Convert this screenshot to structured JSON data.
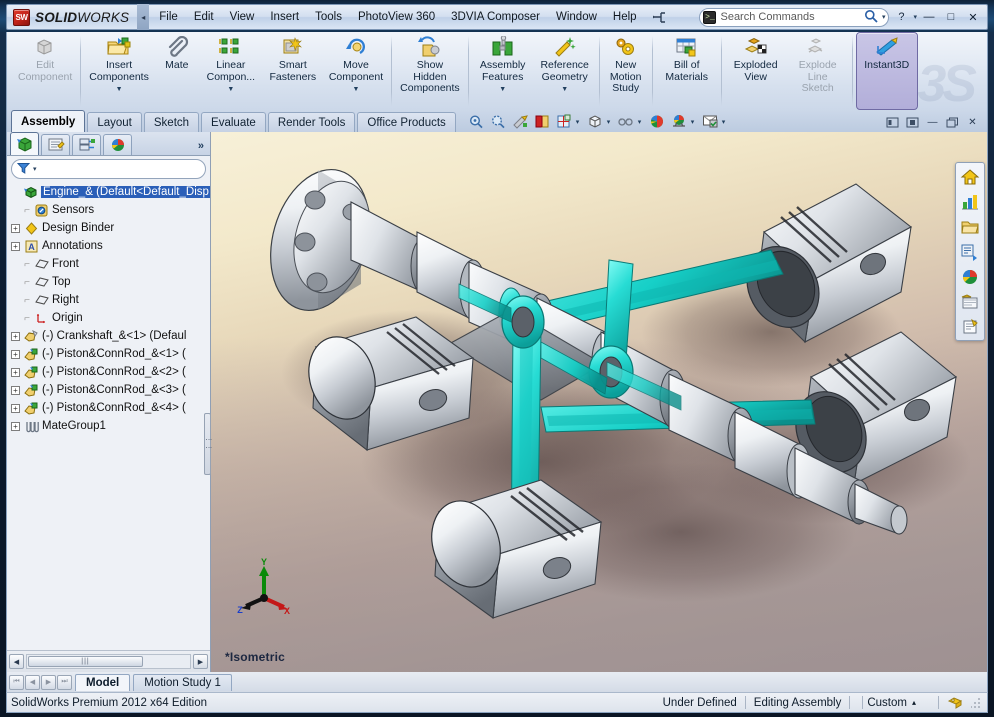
{
  "app": {
    "brand_sw": "SOLID",
    "brand_works": "WORKS",
    "logo_text": "SW",
    "watermark": "3S"
  },
  "menu": {
    "items": [
      {
        "label": "File"
      },
      {
        "label": "Edit"
      },
      {
        "label": "View"
      },
      {
        "label": "Insert"
      },
      {
        "label": "Tools"
      },
      {
        "label": "PhotoView 360"
      },
      {
        "label": "3DVIA Composer"
      },
      {
        "label": "Window"
      },
      {
        "label": "Help"
      }
    ],
    "collapse_arrow": "◂",
    "pin_icon": "pin-icon"
  },
  "search": {
    "placeholder": "Search Commands",
    "dropdown_arrow": "▾",
    "prompt": ">_"
  },
  "titlebar_buttons": {
    "help": "?",
    "help_arrow": "▾",
    "minimize": "—",
    "restore": "□",
    "close": "✕"
  },
  "ribbon": {
    "buttons": [
      {
        "name": "edit-component",
        "label": "Edit\nComponent",
        "disabled": true,
        "dropdown": false
      },
      {
        "name": "insert-components",
        "label": "Insert\nComponents",
        "disabled": false,
        "dropdown": true
      },
      {
        "name": "mate",
        "label": "Mate",
        "disabled": false,
        "dropdown": false
      },
      {
        "name": "linear-component-pattern",
        "label": "Linear\nCompon...",
        "disabled": false,
        "dropdown": true
      },
      {
        "name": "smart-fasteners",
        "label": "Smart\nFasteners",
        "disabled": false,
        "dropdown": false
      },
      {
        "name": "move-component",
        "label": "Move\nComponent",
        "disabled": false,
        "dropdown": true
      },
      {
        "name": "show-hidden-components",
        "label": "Show\nHidden\nComponents",
        "disabled": false,
        "dropdown": false
      },
      {
        "name": "assembly-features",
        "label": "Assembly\nFeatures",
        "disabled": false,
        "dropdown": true
      },
      {
        "name": "reference-geometry",
        "label": "Reference\nGeometry",
        "disabled": false,
        "dropdown": true
      },
      {
        "name": "new-motion-study",
        "label": "New\nMotion\nStudy",
        "disabled": false,
        "dropdown": false
      },
      {
        "name": "bill-of-materials",
        "label": "Bill of\nMaterials",
        "disabled": false,
        "dropdown": false
      },
      {
        "name": "exploded-view",
        "label": "Exploded\nView",
        "disabled": false,
        "dropdown": false
      },
      {
        "name": "explode-line-sketch",
        "label": "Explode\nLine\nSketch",
        "disabled": true,
        "dropdown": false
      },
      {
        "name": "instant3d",
        "label": "Instant3D",
        "disabled": false,
        "dropdown": false,
        "active": true
      }
    ]
  },
  "tabs": {
    "items": [
      {
        "label": "Assembly",
        "selected": true
      },
      {
        "label": "Layout",
        "selected": false
      },
      {
        "label": "Sketch",
        "selected": false
      },
      {
        "label": "Evaluate",
        "selected": false
      },
      {
        "label": "Render Tools",
        "selected": false
      },
      {
        "label": "Office Products",
        "selected": false
      }
    ],
    "view_tools": [
      {
        "name": "zoom-to-fit-icon",
        "dropdown": false
      },
      {
        "name": "zoom-to-area-icon",
        "dropdown": false
      },
      {
        "name": "previous-view-icon",
        "dropdown": false
      },
      {
        "name": "section-view-icon",
        "dropdown": false
      },
      {
        "name": "view-orientation-icon",
        "dropdown": true
      },
      {
        "name": "display-style-icon",
        "dropdown": true
      },
      {
        "name": "hide-show-items-icon",
        "dropdown": true
      },
      {
        "name": "edit-appearance-icon",
        "dropdown": false
      },
      {
        "name": "apply-scene-icon",
        "dropdown": true
      },
      {
        "name": "view-setting-icon",
        "dropdown": true
      }
    ],
    "window_controls": [
      {
        "name": "tile-horizontally-icon",
        "glyph": "⬚"
      },
      {
        "name": "tile-vertically-icon",
        "glyph": "⬚"
      },
      {
        "name": "minimize-document-icon",
        "glyph": "—"
      },
      {
        "name": "restore-document-icon",
        "glyph": "❐"
      },
      {
        "name": "close-document-icon",
        "glyph": "✕"
      }
    ]
  },
  "tree_panel": {
    "tabs": [
      {
        "name": "feature-manager-tab",
        "selected": true
      },
      {
        "name": "property-manager-tab",
        "selected": false
      },
      {
        "name": "configuration-manager-tab",
        "selected": false
      },
      {
        "name": "display-manager-tab",
        "selected": false
      }
    ],
    "more_tabs": "»",
    "filter_placeholder": "",
    "filter_arrow": "▾",
    "items": [
      {
        "label": "Engine_&  (Default<Default_Disp",
        "icon": "assembly-icon",
        "indent": 0,
        "expander": "none",
        "selected": true
      },
      {
        "label": "Sensors",
        "icon": "sensors-icon",
        "indent": 1,
        "expander": "none",
        "selected": false
      },
      {
        "label": "Design Binder",
        "icon": "design-binder-icon",
        "indent": 1,
        "expander": "plus",
        "selected": false
      },
      {
        "label": "Annotations",
        "icon": "annotations-icon",
        "indent": 1,
        "expander": "plus",
        "selected": false
      },
      {
        "label": "Front",
        "icon": "plane-icon",
        "indent": 1,
        "expander": "none",
        "selected": false
      },
      {
        "label": "Top",
        "icon": "plane-icon",
        "indent": 1,
        "expander": "none",
        "selected": false
      },
      {
        "label": "Right",
        "icon": "plane-icon",
        "indent": 1,
        "expander": "none",
        "selected": false
      },
      {
        "label": "Origin",
        "icon": "origin-icon",
        "indent": 1,
        "expander": "none",
        "selected": false
      },
      {
        "label": "(-) Crankshaft_&<1> (Defaul",
        "icon": "part-icon",
        "indent": 0,
        "expander": "plus",
        "selected": false
      },
      {
        "label": "(-) Piston&ConnRod_&<1> (",
        "icon": "subassembly-icon",
        "indent": 0,
        "expander": "plus",
        "selected": false
      },
      {
        "label": "(-) Piston&ConnRod_&<2> (",
        "icon": "subassembly-icon",
        "indent": 0,
        "expander": "plus",
        "selected": false
      },
      {
        "label": "(-) Piston&ConnRod_&<3> (",
        "icon": "subassembly-icon",
        "indent": 0,
        "expander": "plus",
        "selected": false
      },
      {
        "label": "(-) Piston&ConnRod_&<4> (",
        "icon": "subassembly-icon",
        "indent": 0,
        "expander": "plus",
        "selected": false
      },
      {
        "label": "MateGroup1",
        "icon": "mategroup-icon",
        "indent": 0,
        "expander": "plus",
        "selected": false
      }
    ],
    "hscroll": {
      "left_arrow": "◀",
      "right_arrow": "▶",
      "thumb_grip": "|||"
    }
  },
  "viewport": {
    "orientation_label": "*Isometric",
    "triad": {
      "x": "X",
      "y": "Y",
      "z": "Z"
    },
    "colors": {
      "bg_top": "#f7f0d8",
      "bg_bottom": "#9f9295",
      "part_highlight": "#18d8d0",
      "part_metal": "#d8dde3"
    },
    "right_toolbar": [
      {
        "name": "home-view-icon"
      },
      {
        "name": "solidworks-resources-icon"
      },
      {
        "name": "design-library-icon"
      },
      {
        "name": "file-explorer-icon"
      },
      {
        "name": "view-palette-icon"
      },
      {
        "name": "appearances-scenes-icon"
      },
      {
        "name": "custom-properties-icon"
      }
    ]
  },
  "bottom_tabs": {
    "nav": [
      {
        "name": "first-tab-button",
        "glyph": "⏮"
      },
      {
        "name": "previous-tab-button",
        "glyph": "◀"
      },
      {
        "name": "next-tab-button",
        "glyph": "▶"
      },
      {
        "name": "last-tab-button",
        "glyph": "⏭"
      }
    ],
    "items": [
      {
        "label": "Model",
        "selected": true
      },
      {
        "label": "Motion Study 1",
        "selected": false
      }
    ]
  },
  "statusbar": {
    "edition": "SolidWorks Premium 2012 x64 Edition",
    "sketch_state": "Under Defined",
    "edit_mode": "Editing Assembly",
    "units": "Custom",
    "units_arrow": "▴",
    "tag_icon": "tag-icon"
  }
}
